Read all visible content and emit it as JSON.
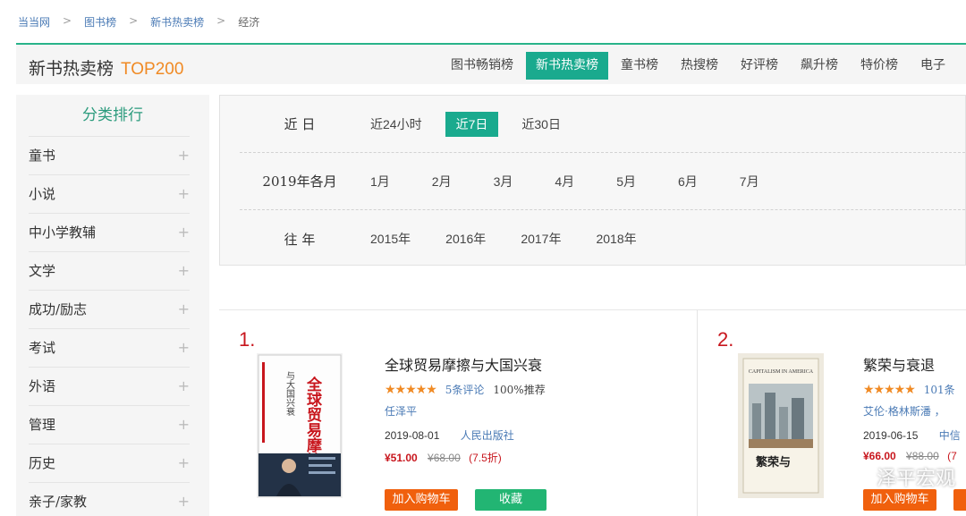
{
  "breadcrumb": [
    "当当网",
    "图书榜",
    "新书热卖榜",
    "经济"
  ],
  "header": {
    "title": "新书热卖榜",
    "top_label": "TOP200",
    "nav": [
      "图书畅销榜",
      "新书热卖榜",
      "童书榜",
      "热搜榜",
      "好评榜",
      "飙升榜",
      "特价榜",
      "电子"
    ]
  },
  "sidebar": {
    "title": "分类排行",
    "items": [
      "童书",
      "小说",
      "中小学教辅",
      "文学",
      "成功/励志",
      "考试",
      "外语",
      "管理",
      "历史",
      "亲子/家教"
    ],
    "plus": "+"
  },
  "filters": {
    "recent_label": "近 日",
    "recent": [
      "近24小时",
      "近7日",
      "近30日"
    ],
    "month_label": "2019年各月",
    "months": [
      "1月",
      "2月",
      "3月",
      "4月",
      "5月",
      "6月",
      "7月"
    ],
    "year_label": "往 年",
    "years": [
      "2015年",
      "2016年",
      "2017年",
      "2018年"
    ]
  },
  "books": [
    {
      "rank": "1.",
      "title": "全球贸易摩擦与大国兴衰",
      "stars": "★★★★★",
      "reviews": "5条评论",
      "recommend": "100%推荐",
      "author": "任泽平",
      "date": "2019-08-01",
      "publisher": "人民出版社",
      "price": "¥51.00",
      "original_price": "¥68.00",
      "discount": "(7.5折)",
      "cart_label": "加入购物车",
      "fav_label": "收藏",
      "cover_text": "全球贸易摩擦",
      "cover_sub": "与大国兴衰"
    },
    {
      "rank": "2.",
      "title": "繁荣与衰退",
      "stars": "★★★★★",
      "reviews": "101条",
      "author": "艾伦·格林斯潘 ，",
      "date": "2019-06-15",
      "publisher": "中信",
      "price": "¥66.00",
      "original_price": "¥88.00",
      "discount": "(7",
      "cart_label": "加入购物车",
      "cover_text": "CAPITALISM IN AMERICA",
      "cover_sub": "繁荣与"
    }
  ],
  "watermark": "泽平宏观",
  "colors": {
    "accent": "#1aaa8e",
    "price": "#c8161d",
    "stars": "#f08a24",
    "cart": "#f0600d",
    "fav": "#22b573"
  }
}
